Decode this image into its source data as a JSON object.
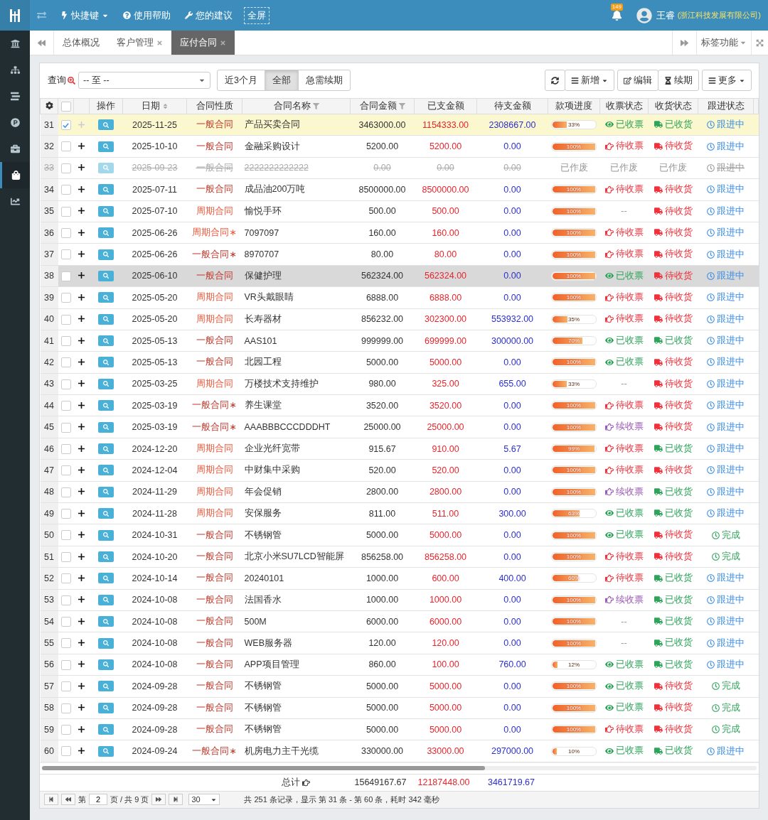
{
  "topbar": {
    "menu": [
      {
        "kind": "shortcut",
        "label": "快捷键"
      },
      {
        "kind": "help",
        "label": "使用帮助"
      },
      {
        "kind": "feedback",
        "label": "您的建议"
      },
      {
        "kind": "fullscreen",
        "label": "全屏"
      }
    ],
    "notifications": "149",
    "user": "王睿",
    "company": "(浙江科技发展有限公司)"
  },
  "sidebar": {
    "items": [
      {
        "kind": "bank",
        "selected": false
      },
      {
        "kind": "org",
        "selected": false
      },
      {
        "kind": "stream",
        "selected": false
      },
      {
        "kind": "product",
        "selected": false
      },
      {
        "kind": "briefcase",
        "selected": false
      },
      {
        "kind": "bag",
        "selected": true
      },
      {
        "kind": "chart",
        "selected": false
      }
    ]
  },
  "tabs": [
    {
      "label": "总体概况",
      "closable": false,
      "selected": false
    },
    {
      "label": "客户管理",
      "closable": true,
      "selected": false
    },
    {
      "label": "应付合同",
      "closable": true,
      "selected": true
    }
  ],
  "tab_tools": {
    "label": "标签功能"
  },
  "filter": {
    "label": "查询",
    "range": "-- 至 --",
    "periods": [
      {
        "label": "近3个月",
        "selected": false
      },
      {
        "label": "全部",
        "selected": true
      },
      {
        "label": "急需续期",
        "selected": false
      }
    ]
  },
  "actions": [
    {
      "kind": "refresh",
      "caret": false
    },
    {
      "kind": "add",
      "label": "新增",
      "caret": true
    },
    {
      "kind": "edit",
      "label": "编辑",
      "caret": false
    },
    {
      "kind": "renew",
      "label": "续期",
      "caret": false
    },
    {
      "kind": "more",
      "label": "更多",
      "caret": true
    }
  ],
  "table": {
    "select_all": {
      "checked": false
    },
    "columns": [
      {
        "label": "操作",
        "kind": "plain"
      },
      {
        "label": "日期",
        "kind": "sortable"
      },
      {
        "label": "合同性质",
        "kind": "plain"
      },
      {
        "label": "合同名称",
        "kind": "filterable"
      },
      {
        "label": "合同金额",
        "kind": "filterable"
      },
      {
        "label": "已支金额",
        "kind": "plain"
      },
      {
        "label": "待支金额",
        "kind": "plain"
      },
      {
        "label": "款项进度",
        "kind": "plain"
      },
      {
        "label": "收票状态",
        "kind": "plain"
      },
      {
        "label": "收货状态",
        "kind": "plain"
      },
      {
        "label": "跟进状态",
        "kind": "plain"
      }
    ],
    "rows": [
      {
        "no": "31",
        "selected": true,
        "checked": true,
        "highlighted": false,
        "void": false,
        "date": "2025-11-25",
        "type": {
          "kind": "general",
          "text": "一般合同"
        },
        "name": "产品买卖合同",
        "amount": "3463000.00",
        "paid": "1154333.00",
        "unpaid": "2308667.00",
        "progress": {
          "kind": "bar",
          "level": 0.33,
          "label": "33%"
        },
        "invoice": {
          "kind": "received",
          "text": "已收票"
        },
        "goods": {
          "kind": "received",
          "text": "已收货"
        },
        "follow": {
          "kind": "ongoing",
          "text": "跟进中"
        }
      },
      {
        "no": "32",
        "selected": false,
        "checked": false,
        "highlighted": false,
        "void": false,
        "date": "2025-10-10",
        "type": {
          "kind": "general",
          "text": "一般合同"
        },
        "name": "金融采购设计",
        "amount": "5200.00",
        "paid": "5200.00",
        "unpaid": "0.00",
        "progress": {
          "kind": "bar",
          "level": 1,
          "label": "100%"
        },
        "invoice": {
          "kind": "pending",
          "text": "待收票"
        },
        "goods": {
          "kind": "pending",
          "text": "待收货"
        },
        "follow": {
          "kind": "ongoing",
          "text": "跟进中"
        }
      },
      {
        "no": "33",
        "selected": false,
        "checked": false,
        "highlighted": false,
        "void": true,
        "date": "2025-09-23",
        "type": {
          "kind": "general",
          "text": "一般合同"
        },
        "name": "2222222222222",
        "amount": "0.00",
        "paid": "0.00",
        "unpaid": "0.00",
        "progress": {
          "kind": "text",
          "text": "已作废"
        },
        "invoice": {
          "kind": "void",
          "text": "已作废"
        },
        "goods": {
          "kind": "void",
          "text": "已作废"
        },
        "follow": {
          "kind": "void",
          "text": "跟进中"
        }
      },
      {
        "no": "34",
        "selected": false,
        "checked": false,
        "highlighted": false,
        "void": false,
        "date": "2025-07-11",
        "type": {
          "kind": "general",
          "text": "一般合同"
        },
        "name": "成品油200万吨",
        "amount": "8500000.00",
        "paid": "8500000.00",
        "unpaid": "0.00",
        "progress": {
          "kind": "bar",
          "level": 1,
          "label": "100%"
        },
        "invoice": {
          "kind": "pending",
          "text": "待收票"
        },
        "goods": {
          "kind": "pending",
          "text": "待收货"
        },
        "follow": {
          "kind": "ongoing",
          "text": "跟进中"
        }
      },
      {
        "no": "35",
        "selected": false,
        "checked": false,
        "highlighted": false,
        "void": false,
        "date": "2025-07-10",
        "type": {
          "kind": "periodic",
          "text": "周期合同"
        },
        "name": "愉悦手环",
        "amount": "500.00",
        "paid": "500.00",
        "unpaid": "0.00",
        "progress": {
          "kind": "bar",
          "level": 1,
          "label": "100%"
        },
        "invoice": {
          "kind": "none",
          "text": "--"
        },
        "goods": {
          "kind": "pending",
          "text": "待收货"
        },
        "follow": {
          "kind": "ongoing",
          "text": "跟进中"
        }
      },
      {
        "no": "36",
        "selected": false,
        "checked": false,
        "highlighted": false,
        "void": false,
        "date": "2025-06-26",
        "type": {
          "kind": "periodic",
          "text": "周期合同∗"
        },
        "name": "7097097",
        "amount": "160.00",
        "paid": "160.00",
        "unpaid": "0.00",
        "progress": {
          "kind": "bar",
          "level": 1,
          "label": "100%"
        },
        "invoice": {
          "kind": "pending",
          "text": "待收票"
        },
        "goods": {
          "kind": "pending",
          "text": "待收货"
        },
        "follow": {
          "kind": "ongoing",
          "text": "跟进中"
        }
      },
      {
        "no": "37",
        "selected": false,
        "checked": false,
        "highlighted": false,
        "void": false,
        "date": "2025-06-26",
        "type": {
          "kind": "general",
          "text": "一般合同∗"
        },
        "name": "8970707",
        "amount": "80.00",
        "paid": "80.00",
        "unpaid": "0.00",
        "progress": {
          "kind": "bar",
          "level": 1,
          "label": "100%"
        },
        "invoice": {
          "kind": "pending",
          "text": "待收票"
        },
        "goods": {
          "kind": "pending",
          "text": "待收货"
        },
        "follow": {
          "kind": "ongoing",
          "text": "跟进中"
        }
      },
      {
        "no": "38",
        "selected": false,
        "checked": false,
        "highlighted": true,
        "void": false,
        "date": "2025-06-10",
        "type": {
          "kind": "general",
          "text": "一般合同"
        },
        "name": "保健护理",
        "amount": "562324.00",
        "paid": "562324.00",
        "unpaid": "0.00",
        "progress": {
          "kind": "bar",
          "level": 1,
          "label": "100%"
        },
        "invoice": {
          "kind": "received",
          "text": "已收票"
        },
        "goods": {
          "kind": "pending",
          "text": "待收货"
        },
        "follow": {
          "kind": "ongoing",
          "text": "跟进中"
        }
      },
      {
        "no": "39",
        "selected": false,
        "checked": false,
        "highlighted": false,
        "void": false,
        "date": "2025-05-20",
        "type": {
          "kind": "periodic",
          "text": "周期合同"
        },
        "name": "VR头戴眼睛",
        "amount": "6888.00",
        "paid": "6888.00",
        "unpaid": "0.00",
        "progress": {
          "kind": "bar",
          "level": 1,
          "label": "100%"
        },
        "invoice": {
          "kind": "pending",
          "text": "待收票"
        },
        "goods": {
          "kind": "pending",
          "text": "待收货"
        },
        "follow": {
          "kind": "ongoing",
          "text": "跟进中"
        }
      },
      {
        "no": "40",
        "selected": false,
        "checked": false,
        "highlighted": false,
        "void": false,
        "date": "2025-05-20",
        "type": {
          "kind": "periodic",
          "text": "周期合同"
        },
        "name": "长寿器材",
        "amount": "856232.00",
        "paid": "302300.00",
        "unpaid": "553932.00",
        "progress": {
          "kind": "bar",
          "level": 0.35,
          "label": "35%"
        },
        "invoice": {
          "kind": "pending",
          "text": "待收票"
        },
        "goods": {
          "kind": "pending",
          "text": "待收货"
        },
        "follow": {
          "kind": "ongoing",
          "text": "跟进中"
        }
      },
      {
        "no": "41",
        "selected": false,
        "checked": false,
        "highlighted": false,
        "void": false,
        "date": "2025-05-13",
        "type": {
          "kind": "general",
          "text": "一般合同"
        },
        "name": "AAS101",
        "amount": "999999.00",
        "paid": "699999.00",
        "unpaid": "300000.00",
        "progress": {
          "kind": "bar",
          "level": 0.7,
          "label": "70%"
        },
        "invoice": {
          "kind": "received",
          "text": "已收票"
        },
        "goods": {
          "kind": "received",
          "text": "已收货"
        },
        "follow": {
          "kind": "ongoing",
          "text": "跟进中"
        }
      },
      {
        "no": "42",
        "selected": false,
        "checked": false,
        "highlighted": false,
        "void": false,
        "date": "2025-05-13",
        "type": {
          "kind": "general",
          "text": "一般合同"
        },
        "name": "北园工程",
        "amount": "5000.00",
        "paid": "5000.00",
        "unpaid": "0.00",
        "progress": {
          "kind": "bar",
          "level": 1,
          "label": "100%"
        },
        "invoice": {
          "kind": "received",
          "text": "已收票"
        },
        "goods": {
          "kind": "pending",
          "text": "待收货"
        },
        "follow": {
          "kind": "ongoing",
          "text": "跟进中"
        }
      },
      {
        "no": "43",
        "selected": false,
        "checked": false,
        "highlighted": false,
        "void": false,
        "date": "2025-03-25",
        "type": {
          "kind": "periodic",
          "text": "周期合同"
        },
        "name": "万楼技术支持维护",
        "amount": "980.00",
        "paid": "325.00",
        "unpaid": "655.00",
        "progress": {
          "kind": "bar",
          "level": 0.33,
          "label": "33%"
        },
        "invoice": {
          "kind": "none",
          "text": "--"
        },
        "goods": {
          "kind": "pending",
          "text": "待收货"
        },
        "follow": {
          "kind": "ongoing",
          "text": "跟进中"
        }
      },
      {
        "no": "44",
        "selected": false,
        "checked": false,
        "highlighted": false,
        "void": false,
        "date": "2025-03-19",
        "type": {
          "kind": "general",
          "text": "一般合同∗"
        },
        "name": "养生课堂",
        "amount": "3520.00",
        "paid": "3520.00",
        "unpaid": "0.00",
        "progress": {
          "kind": "bar",
          "level": 1,
          "label": "100%"
        },
        "invoice": {
          "kind": "pending",
          "text": "待收票"
        },
        "goods": {
          "kind": "pending",
          "text": "待收货"
        },
        "follow": {
          "kind": "ongoing",
          "text": "跟进中"
        }
      },
      {
        "no": "45",
        "selected": false,
        "checked": false,
        "highlighted": false,
        "void": false,
        "date": "2025-03-19",
        "type": {
          "kind": "general",
          "text": "一般合同∗"
        },
        "name": "AAABBBCCCDDDHT",
        "amount": "25000.00",
        "paid": "25000.00",
        "unpaid": "0.00",
        "progress": {
          "kind": "bar",
          "level": 1,
          "label": "100%"
        },
        "invoice": {
          "kind": "renew",
          "text": "续收票"
        },
        "goods": {
          "kind": "pending",
          "text": "待收货"
        },
        "follow": {
          "kind": "ongoing",
          "text": "跟进中"
        }
      },
      {
        "no": "46",
        "selected": false,
        "checked": false,
        "highlighted": false,
        "void": false,
        "date": "2024-12-20",
        "type": {
          "kind": "periodic",
          "text": "周期合同"
        },
        "name": "企业光纤宽带",
        "amount": "915.67",
        "paid": "910.00",
        "unpaid": "5.67",
        "progress": {
          "kind": "bar",
          "level": 0.99,
          "label": "99%"
        },
        "invoice": {
          "kind": "pending",
          "text": "待收票"
        },
        "goods": {
          "kind": "received",
          "text": "已收货"
        },
        "follow": {
          "kind": "ongoing",
          "text": "跟进中"
        }
      },
      {
        "no": "47",
        "selected": false,
        "checked": false,
        "highlighted": false,
        "void": false,
        "date": "2024-12-04",
        "type": {
          "kind": "periodic",
          "text": "周期合同"
        },
        "name": "中财集中采购",
        "amount": "520.00",
        "paid": "520.00",
        "unpaid": "0.00",
        "progress": {
          "kind": "bar",
          "level": 1,
          "label": "100%"
        },
        "invoice": {
          "kind": "pending",
          "text": "待收票"
        },
        "goods": {
          "kind": "pending",
          "text": "待收货"
        },
        "follow": {
          "kind": "ongoing",
          "text": "跟进中"
        }
      },
      {
        "no": "48",
        "selected": false,
        "checked": false,
        "highlighted": false,
        "void": false,
        "date": "2024-11-29",
        "type": {
          "kind": "periodic",
          "text": "周期合同"
        },
        "name": "年会促销",
        "amount": "2800.00",
        "paid": "2800.00",
        "unpaid": "0.00",
        "progress": {
          "kind": "bar",
          "level": 1,
          "label": "100%"
        },
        "invoice": {
          "kind": "renew",
          "text": "续收票"
        },
        "goods": {
          "kind": "received",
          "text": "已收货"
        },
        "follow": {
          "kind": "ongoing",
          "text": "跟进中"
        }
      },
      {
        "no": "49",
        "selected": false,
        "checked": false,
        "highlighted": false,
        "void": false,
        "date": "2024-11-28",
        "type": {
          "kind": "periodic",
          "text": "周期合同"
        },
        "name": "安保服务",
        "amount": "811.00",
        "paid": "511.00",
        "unpaid": "300.00",
        "progress": {
          "kind": "bar",
          "level": 0.63,
          "label": "63%"
        },
        "invoice": {
          "kind": "received",
          "text": "已收票"
        },
        "goods": {
          "kind": "received",
          "text": "已收货"
        },
        "follow": {
          "kind": "ongoing",
          "text": "跟进中"
        }
      },
      {
        "no": "50",
        "selected": false,
        "checked": false,
        "highlighted": false,
        "void": false,
        "date": "2024-10-31",
        "type": {
          "kind": "general",
          "text": "一般合同"
        },
        "name": "不锈钢管",
        "amount": "5000.00",
        "paid": "5000.00",
        "unpaid": "0.00",
        "progress": {
          "kind": "bar",
          "level": 1,
          "label": "100%"
        },
        "invoice": {
          "kind": "received",
          "text": "已收票"
        },
        "goods": {
          "kind": "pending",
          "text": "待收货"
        },
        "follow": {
          "kind": "done",
          "text": "完成"
        }
      },
      {
        "no": "51",
        "selected": false,
        "checked": false,
        "highlighted": false,
        "void": false,
        "date": "2024-10-20",
        "type": {
          "kind": "general",
          "text": "一般合同"
        },
        "name": "北京小米SU7LCD智能屏",
        "amount": "856258.00",
        "paid": "856258.00",
        "unpaid": "0.00",
        "progress": {
          "kind": "bar",
          "level": 1,
          "label": "100%"
        },
        "invoice": {
          "kind": "pending",
          "text": "待收票"
        },
        "goods": {
          "kind": "pending",
          "text": "待收货"
        },
        "follow": {
          "kind": "done",
          "text": "完成"
        }
      },
      {
        "no": "52",
        "selected": false,
        "checked": false,
        "highlighted": false,
        "void": false,
        "date": "2024-10-14",
        "type": {
          "kind": "general",
          "text": "一般合同"
        },
        "name": "20240101",
        "amount": "1000.00",
        "paid": "600.00",
        "unpaid": "400.00",
        "progress": {
          "kind": "bar",
          "level": 0.6,
          "label": "60%"
        },
        "invoice": {
          "kind": "pending",
          "text": "待收票"
        },
        "goods": {
          "kind": "received",
          "text": "已收货"
        },
        "follow": {
          "kind": "ongoing",
          "text": "跟进中"
        }
      },
      {
        "no": "53",
        "selected": false,
        "checked": false,
        "highlighted": false,
        "void": false,
        "date": "2024-10-08",
        "type": {
          "kind": "general",
          "text": "一般合同"
        },
        "name": "法国香水",
        "amount": "1000.00",
        "paid": "1000.00",
        "unpaid": "0.00",
        "progress": {
          "kind": "bar",
          "level": 1,
          "label": "100%"
        },
        "invoice": {
          "kind": "renew",
          "text": "续收票"
        },
        "goods": {
          "kind": "received",
          "text": "已收货"
        },
        "follow": {
          "kind": "ongoing",
          "text": "跟进中"
        }
      },
      {
        "no": "54",
        "selected": false,
        "checked": false,
        "highlighted": false,
        "void": false,
        "date": "2024-10-08",
        "type": {
          "kind": "general",
          "text": "一般合同"
        },
        "name": "500M",
        "amount": "6000.00",
        "paid": "6000.00",
        "unpaid": "0.00",
        "progress": {
          "kind": "bar",
          "level": 1,
          "label": "100%"
        },
        "invoice": {
          "kind": "none",
          "text": "--"
        },
        "goods": {
          "kind": "received",
          "text": "已收货"
        },
        "follow": {
          "kind": "ongoing",
          "text": "跟进中"
        }
      },
      {
        "no": "55",
        "selected": false,
        "checked": false,
        "highlighted": false,
        "void": false,
        "date": "2024-10-08",
        "type": {
          "kind": "general",
          "text": "一般合同"
        },
        "name": "WEB服务器",
        "amount": "120.00",
        "paid": "120.00",
        "unpaid": "0.00",
        "progress": {
          "kind": "bar",
          "level": 1,
          "label": "100%"
        },
        "invoice": {
          "kind": "none",
          "text": "--"
        },
        "goods": {
          "kind": "received",
          "text": "已收货"
        },
        "follow": {
          "kind": "ongoing",
          "text": "跟进中"
        }
      },
      {
        "no": "56",
        "selected": false,
        "checked": false,
        "highlighted": false,
        "void": false,
        "date": "2024-10-08",
        "type": {
          "kind": "general",
          "text": "一般合同"
        },
        "name": "APP项目管理",
        "amount": "860.00",
        "paid": "100.00",
        "unpaid": "760.00",
        "progress": {
          "kind": "bar",
          "level": 0.12,
          "label": "12%"
        },
        "invoice": {
          "kind": "received",
          "text": "已收票"
        },
        "goods": {
          "kind": "received",
          "text": "已收货"
        },
        "follow": {
          "kind": "ongoing",
          "text": "跟进中"
        }
      },
      {
        "no": "57",
        "selected": false,
        "checked": false,
        "highlighted": false,
        "void": false,
        "date": "2024-09-28",
        "type": {
          "kind": "general",
          "text": "一般合同"
        },
        "name": "不锈钢管",
        "amount": "5000.00",
        "paid": "5000.00",
        "unpaid": "0.00",
        "progress": {
          "kind": "bar",
          "level": 1,
          "label": "100%"
        },
        "invoice": {
          "kind": "received",
          "text": "已收票"
        },
        "goods": {
          "kind": "pending",
          "text": "待收货"
        },
        "follow": {
          "kind": "done",
          "text": "完成"
        }
      },
      {
        "no": "58",
        "selected": false,
        "checked": false,
        "highlighted": false,
        "void": false,
        "date": "2024-09-28",
        "type": {
          "kind": "general",
          "text": "一般合同"
        },
        "name": "不锈钢管",
        "amount": "5000.00",
        "paid": "5000.00",
        "unpaid": "0.00",
        "progress": {
          "kind": "bar",
          "level": 1,
          "label": "100%"
        },
        "invoice": {
          "kind": "received",
          "text": "已收票"
        },
        "goods": {
          "kind": "pending",
          "text": "待收货"
        },
        "follow": {
          "kind": "done",
          "text": "完成"
        }
      },
      {
        "no": "59",
        "selected": false,
        "checked": false,
        "highlighted": false,
        "void": false,
        "date": "2024-09-28",
        "type": {
          "kind": "general",
          "text": "一般合同"
        },
        "name": "不锈钢管",
        "amount": "5000.00",
        "paid": "5000.00",
        "unpaid": "0.00",
        "progress": {
          "kind": "bar",
          "level": 1,
          "label": "100%"
        },
        "invoice": {
          "kind": "pending",
          "text": "待收票"
        },
        "goods": {
          "kind": "pending",
          "text": "待收货"
        },
        "follow": {
          "kind": "done",
          "text": "完成"
        }
      },
      {
        "no": "60",
        "selected": false,
        "checked": false,
        "highlighted": false,
        "void": false,
        "date": "2024-09-24",
        "type": {
          "kind": "general",
          "text": "一般合同∗"
        },
        "name": "机房电力主干光缆",
        "amount": "330000.00",
        "paid": "33000.00",
        "unpaid": "297000.00",
        "progress": {
          "kind": "bar",
          "level": 0.1,
          "label": "10%"
        },
        "invoice": {
          "kind": "received",
          "text": "已收票"
        },
        "goods": {
          "kind": "received",
          "text": "已收货"
        },
        "follow": {
          "kind": "ongoing",
          "text": "跟进中"
        }
      }
    ],
    "totals": {
      "label": "总计",
      "amount": "15649167.67",
      "paid": "12187448.00",
      "unpaid": "3461719.67"
    }
  },
  "pager": {
    "page_prefix": "第",
    "page": "2",
    "page_suffix": "页 / 共 9 页",
    "page_size": "30",
    "summary": "共 251 条记录，显示 第 31 条 - 第 60 条，耗时 342 毫秒"
  }
}
